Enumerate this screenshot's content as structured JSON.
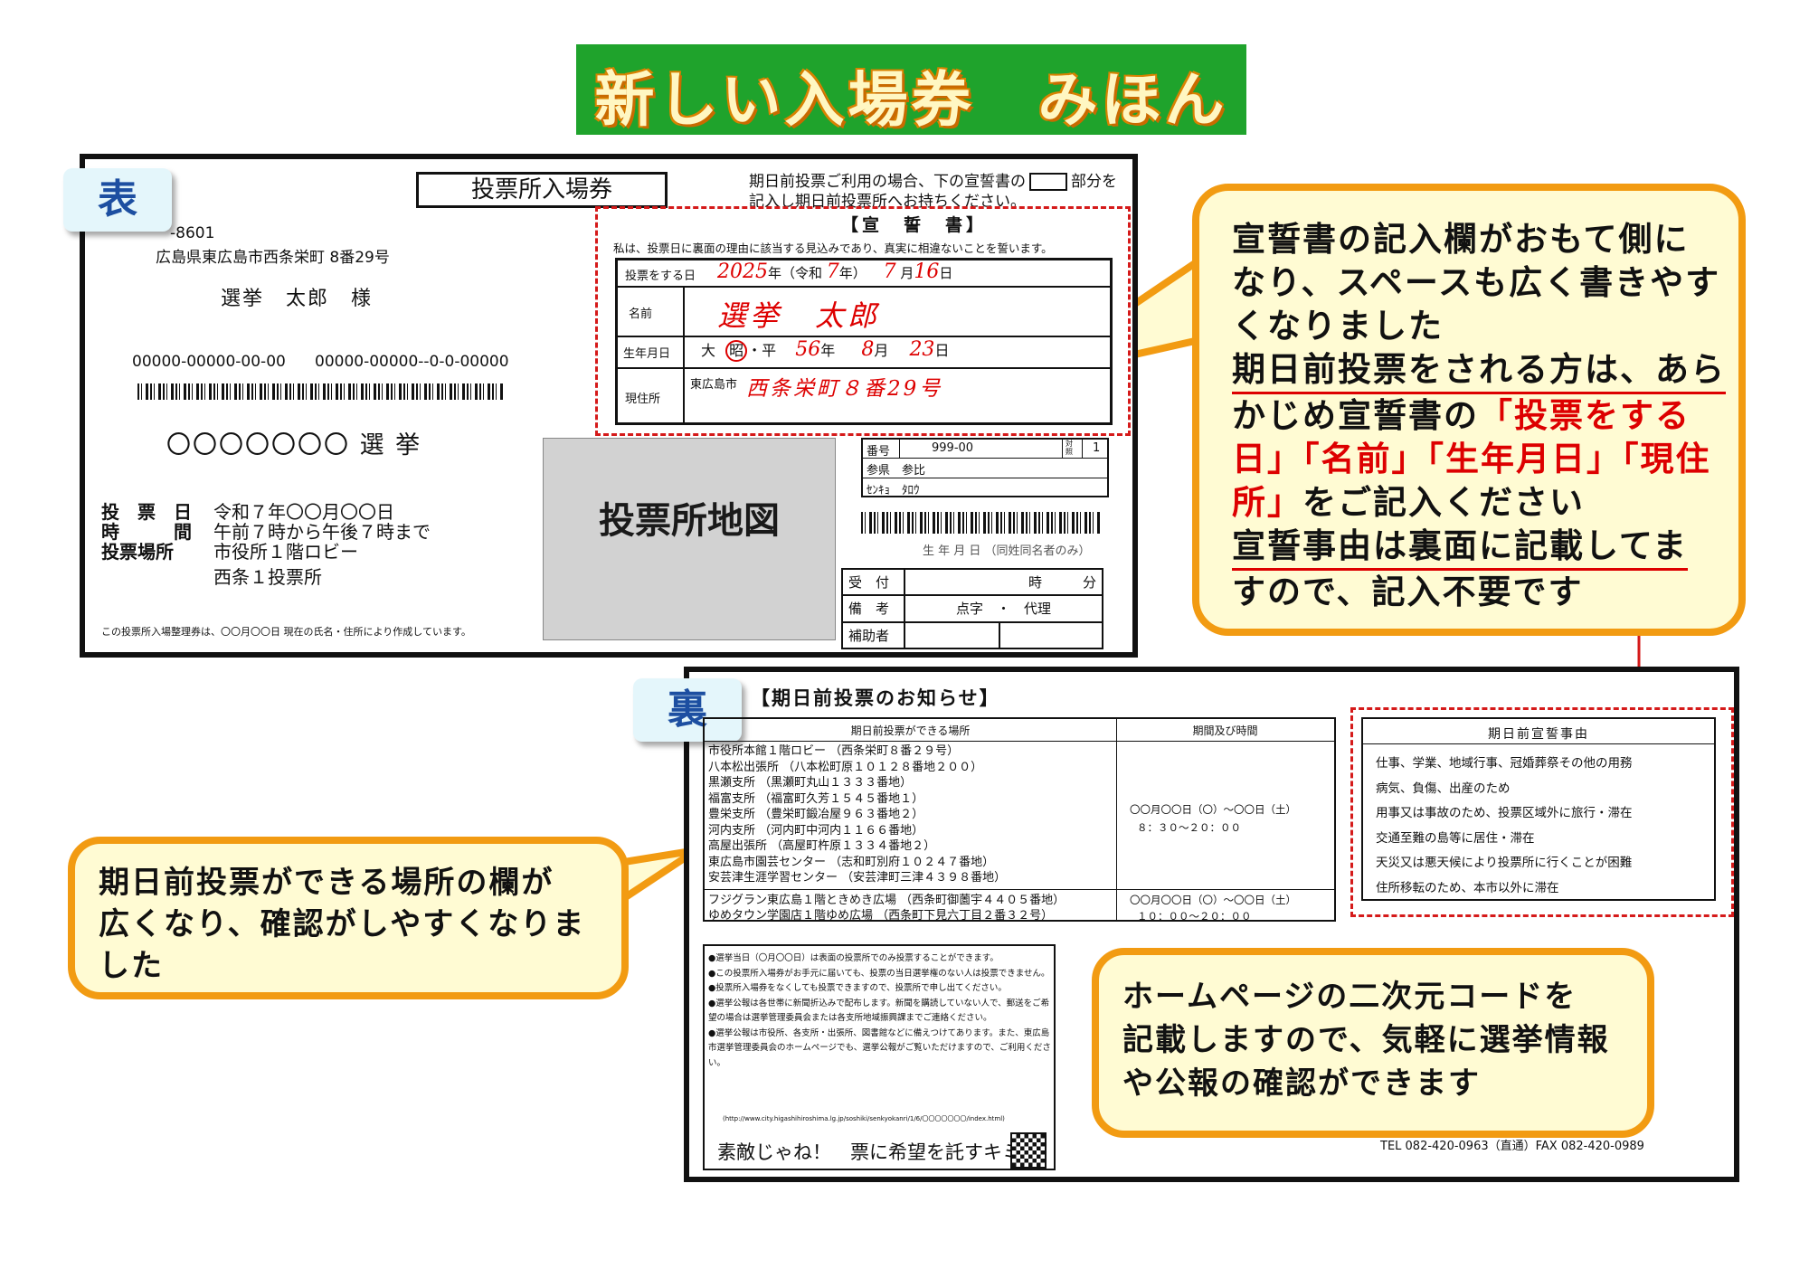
{
  "title": "新しい入場券　みほん",
  "front": {
    "tab": "表",
    "header_label": "投票所入場券",
    "note_line1": "期日前投票ご利用の場合、下の宣誓書の",
    "note_line1_tail": "部分を",
    "note_line2": "記入し期日前投票所へお持ちください。",
    "postal": "-8601",
    "address": "広島県東広島市西条栄町 8番29号",
    "recipient": "選挙　太郎　様",
    "id_left": "00000-00000-00-00",
    "id_right": "00000-00000--0-0-00000",
    "election": "〇〇〇〇〇〇〇 選 挙",
    "vote_day_label": "投　票　日",
    "vote_day_value": "令和７年〇〇月〇〇日",
    "time_label": "時　　　間",
    "time_value": "午前７時から午後７時まで",
    "place_label": "投票場所",
    "place_value1": "市役所１階ロビー",
    "place_value2": "西条１投票所",
    "footnote": "この投票所入場整理券は、〇〇月〇〇日 現在の氏名・住所により作成しています。",
    "map_label": "投票所地図",
    "oath": {
      "title": "【宣　誓　書】",
      "statement": "私は、投票日に裏面の理由に該当する見込みであり、真実に相違ないことを誓います。",
      "date_label": "投票をする日",
      "date_year": "2025",
      "date_era_prefix": "年（令和",
      "date_era": "7",
      "date_era_suffix": "年）",
      "date_month": "7",
      "date_month_suffix": "月",
      "date_day": "16",
      "date_day_suffix": "日",
      "name_label": "名前",
      "name_value": "選挙　太郎",
      "birth_label": "生年月日",
      "birth_era_a": "大",
      "birth_era_b": "昭",
      "birth_era_c": "・平",
      "birth_year": "56",
      "birth_year_suffix": "年",
      "birth_month": "8",
      "birth_month_suffix": "月",
      "birth_day": "23",
      "birth_day_suffix": "日",
      "address_label": "現住所",
      "address_prefix": "東広島市",
      "address_value": "西条栄町８番29号"
    },
    "info": {
      "number_label": "番号",
      "number_value": "999-00",
      "count_label": "対\n照",
      "count_value": "1",
      "name_kanji": "参県　参比",
      "name_kana": "ｾﾝｷｮ　ﾀﾛｳ",
      "birth_note": "生 年 月 日 （同姓同名者のみ）"
    },
    "reception": {
      "accept_label": "受　付",
      "accept_value": "時　　　分",
      "remarks_label": "備　考",
      "remarks_value": "点字　・　代理",
      "assist_label": "補助者"
    }
  },
  "back": {
    "tab": "裏",
    "heading": "【期日前投票のお知らせ】",
    "col_place": "期日前投票ができる場所",
    "col_period": "期間及び時間",
    "places": [
      "市役所本館１階ロビー （西条栄町８番２９号）",
      "八本松出張所 （八本松町原１０１２８番地２００）",
      "黒瀬支所 （黒瀬町丸山１３３３番地）",
      "福富支所 （福富町久芳１５４５番地１）",
      "豊栄支所 （豊栄町鍛冶屋９６３番地２）",
      "河内支所 （河内町中河内１１６６番地）",
      "高屋出張所 （高屋町杵原１３３４番地２）",
      "東広島市園芸センター （志和町別府１０２４７番地）",
      "安芸津生涯学習センター （安芸津町三津４３９８番地）"
    ],
    "period1_a": "〇〇月〇〇日（〇）～〇〇日（土）",
    "period1_b": "８：３０～２０：００",
    "places2": [
      "フジグラン東広島１階ときめき広場 （西条町御薗宇４４０５番地）",
      "ゆめタウン学園店１階ゆめ広場 （西条町下見六丁目２番３２号）"
    ],
    "period2_a": "〇〇月〇〇日（〇）～〇〇日（土）",
    "period2_b": "１０：００～２０：００",
    "reasons_title": "期日前宣誓事由",
    "reasons": [
      "仕事、学業、地域行事、冠婚葬祭その他の用務",
      "病気、負傷、出産のため",
      "用事又は事故のため、投票区域外に旅行・滞在",
      "交通至難の島等に居住・滞在",
      "天災又は悪天候により投票所に行くことが困難",
      "住所移転のため、本市以外に滞在"
    ],
    "notes": [
      "●選挙当日（〇月〇〇日）は表面の投票所でのみ投票することができます。",
      "●この投票所入場券がお手元に届いても、投票の当日選挙権のない人は投票できません。",
      "●投票所入場券をなくしても投票できますので、投票所で申し出てください。",
      "●選挙公報は各世帯に新聞折込みで配布します。新聞を購読していない人で、郵送をご希望の場合は選挙管理委員会または各支所地域振興課までご連絡ください。",
      "●選挙公報は市役所、各支所・出張所、図書館などに備えつけてあります。また、東広島市選挙管理委員会のホームページでも、選挙公報がご覧いただけますので、ご利用ください。"
    ],
    "url": "(http://www.city.higashihiroshima.lg.jp/soshiki/senkyokanri/1/6/〇〇〇〇〇〇〇/index.html)",
    "slogan": "素敵じゃね！　票に希望を託すキミ",
    "tel": "TEL 082-420-0963（直通）FAX 082-420-0989"
  },
  "callouts": {
    "right": {
      "line1": "宣誓書の記入欄がおもて側に",
      "line2": "なり、スペースも広く書きやす",
      "line3": "くなりました",
      "line4": "期日前投票をされる方は、あら",
      "line5a": "かじめ宣誓書の",
      "line5b": "「投票をする",
      "line6": "日」「名前」「生年月日」「現住",
      "line7a": "所」",
      "line7b": "をご記入ください",
      "line8": "宣誓事由は裏面に記載してま",
      "line9": "すので、記入不要です"
    },
    "left": {
      "line1": "期日前投票ができる場所の欄が",
      "line2": "広くなり、確認がしやすくなりま",
      "line3": "した"
    },
    "bottom": {
      "line1": "ホームページの二次元コードを",
      "line2": "記載しますので、気軽に選挙情報",
      "line3": "や公報の確認ができます"
    }
  },
  "colors": {
    "title_bg": "#1fa32c",
    "callout_border": "#f29b12",
    "callout_bg": "#fffbd3",
    "oath_dash": "#d51a1a",
    "handwriting": "#d00000"
  }
}
